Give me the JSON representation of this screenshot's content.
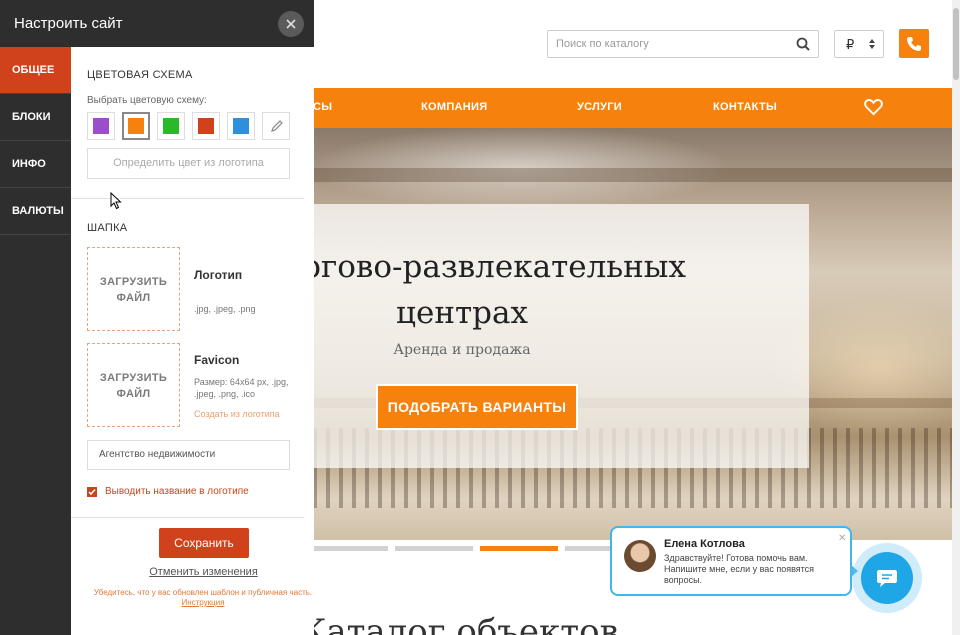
{
  "panel": {
    "title": "Настроить сайт",
    "tabs": [
      {
        "label": "ОБЩЕЕ",
        "active": true
      },
      {
        "label": "БЛОКИ",
        "active": false
      },
      {
        "label": "ИНФО",
        "active": false
      },
      {
        "label": "ВАЛЮТЫ",
        "active": false
      }
    ],
    "color_scheme": {
      "title": "ЦВЕТОВАЯ СХЕМА",
      "choose_label": "Выбрать цветовую схему:",
      "swatches": [
        {
          "name": "purple",
          "color": "#9b4dca"
        },
        {
          "name": "orange",
          "color": "#f6820d",
          "selected": true
        },
        {
          "name": "green",
          "color": "#2bb82b"
        },
        {
          "name": "red",
          "color": "#d0421b"
        },
        {
          "name": "blue",
          "color": "#2f8fdc"
        }
      ],
      "from_logo_button": "Определить цвет из логотипа"
    },
    "header_section": {
      "title": "ШАПКА",
      "logo": {
        "upload_label": "ЗАГРУЗИТЬ ФАЙЛ",
        "name": "Логотип",
        "formats": ".jpg, .jpeg, .png"
      },
      "favicon": {
        "upload_label": "ЗАГРУЗИТЬ ФАЙЛ",
        "name": "Favicon",
        "formats": "Размер: 64x64 px, .jpg, .jpeg, .png, .ico",
        "create_link": "Создать из логотипа"
      },
      "site_name_value": "Агентство недвижимости",
      "show_name_label": "Выводить название в логотипе",
      "show_name_checked": true
    },
    "save_label": "Сохранить",
    "cancel_label": "Отменить изменения",
    "note_text": "Убедитесь, что у вас обновлен шаблон и публичная часть.",
    "note_link": "Инструкция"
  },
  "site": {
    "search_placeholder": "Поиск по каталогу",
    "currency_symbol": "₽",
    "nav": [
      "СЫ",
      "КОМПАНИЯ",
      "УСЛУГИ",
      "КОНТАКТЫ"
    ],
    "hero": {
      "title_line1": "в торгово-развлекательных",
      "title_line2": "центрах",
      "subtitle": "Аренда и продажа",
      "button": "ПОДОБРАТЬ ВАРИАНТЫ"
    },
    "slider_active_index": 2,
    "catalog_title": "Каталог объектов",
    "accent_color": "#f6820d"
  },
  "chat": {
    "agent_name": "Елена Котлова",
    "message": "Здравствуйте! Готова помочь вам. Напишите мне, если у вас появятся вопросы.",
    "close_glyph": "✕"
  }
}
